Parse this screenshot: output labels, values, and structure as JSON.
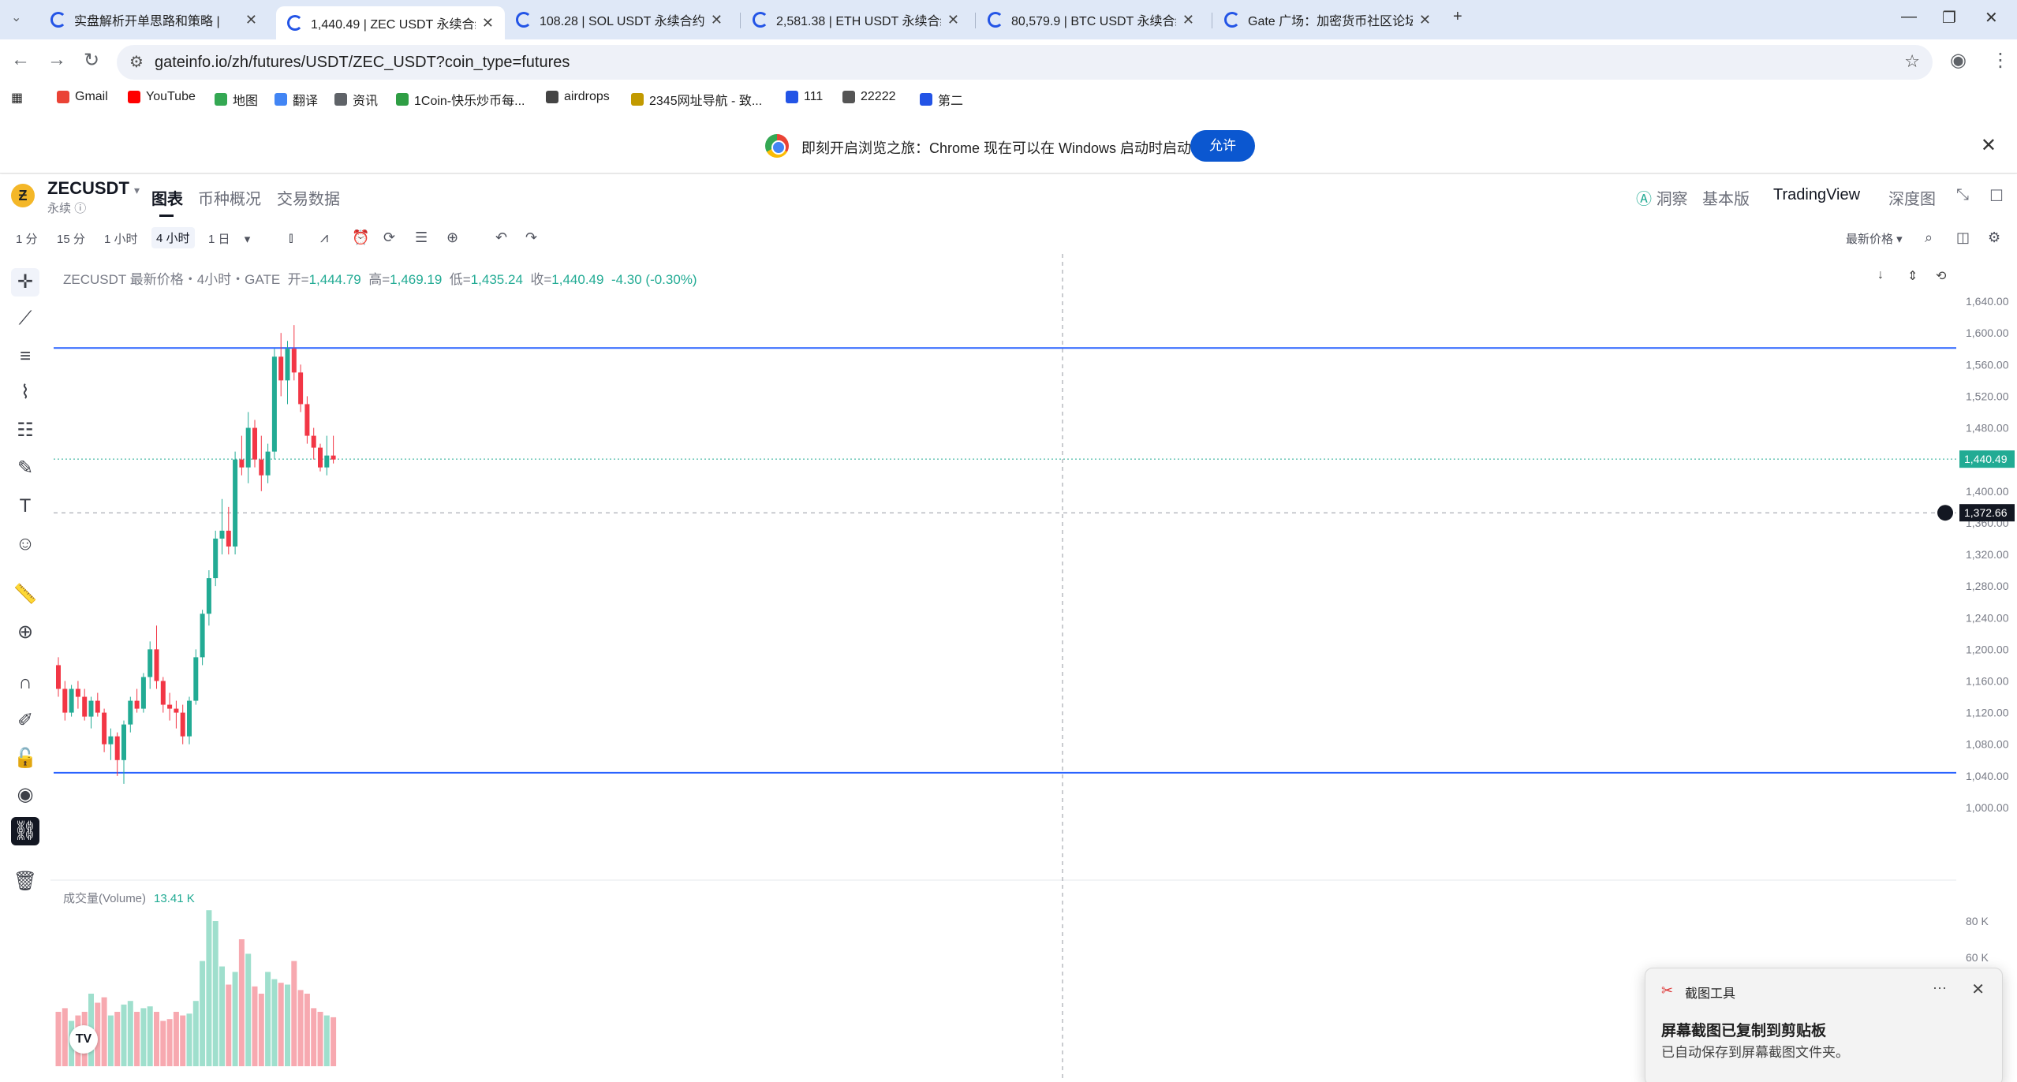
{
  "browser": {
    "tabs": [
      {
        "title": "实盘解析开单思路和策略 |",
        "active": false
      },
      {
        "title": "1,440.49 | ZEC USDT 永续合约",
        "active": true
      },
      {
        "title": "108.28 | SOL USDT 永续合约 |",
        "active": false
      },
      {
        "title": "2,581.38 | ETH USDT 永续合约",
        "active": false
      },
      {
        "title": "80,579.9 | BTC USDT 永续合约",
        "active": false
      },
      {
        "title": "Gate 广场：加密货币社区论坛",
        "active": false
      }
    ],
    "new_tab": "+",
    "url": "gateinfo.io/zh/futures/USDT/ZEC_USDT?coin_type=futures",
    "bookmarks": [
      "Gmail",
      "YouTube",
      "地图",
      "翻译",
      "资讯",
      "1Coin-快乐炒币每...",
      "airdrops",
      "2345网址导航 - 致...",
      "111",
      "22222",
      "第二"
    ],
    "infobar": {
      "text": "即刻开启浏览之旅：Chrome 现在可以在 Windows 启动时启动。",
      "button": "允许"
    }
  },
  "header": {
    "symbol": "ZECUSDT",
    "subtitle": "永续",
    "tabs": [
      "图表",
      "币种概况",
      "交易数据"
    ],
    "right": [
      "洞察",
      "基本版",
      "TradingView",
      "深度图"
    ]
  },
  "toolbar": {
    "timeframes": [
      "1 分",
      "15 分",
      "1 小时",
      "4 小时",
      "1 日"
    ],
    "active_timeframe": "4 小时",
    "price_type": "最新价格"
  },
  "legend": {
    "title": "ZECUSDT 最新价格・4小时・GATE",
    "open_label": "开=",
    "open": "1,444.79",
    "high_label": "高=",
    "high": "1,469.19",
    "low_label": "低=",
    "low": "1,435.24",
    "close_label": "收=",
    "close": "1,440.49",
    "change": "-4.30 (-0.30%)"
  },
  "volume_legend": {
    "label": "成交量(Volume)",
    "value": "13.41 K"
  },
  "colors": {
    "up": "#22ab94",
    "down": "#f23645",
    "hline": "#2962ff"
  },
  "chart_data": {
    "type": "candlestick",
    "y_ticks": [
      "1,640.00",
      "1,600.00",
      "1,560.00",
      "1,520.00",
      "1,480.00",
      "1,440.00",
      "1,400.00",
      "1,360.00",
      "1,320.00",
      "1,280.00",
      "1,240.00",
      "1,200.00",
      "1,160.00",
      "1,120.00",
      "1,080.00",
      "1,040.00",
      "1,000.00"
    ],
    "ylim": [
      990,
      1660
    ],
    "last_price": "1,440.49",
    "crosshair_price": "1,372.66",
    "horizontal_lines": [
      1581,
      1044
    ],
    "volume_ticks": [
      "80 K",
      "60 K"
    ],
    "volume_ylim": [
      0,
      100
    ],
    "candles": [
      [
        1180,
        1190,
        1140,
        1150
      ],
      [
        1150,
        1160,
        1110,
        1120
      ],
      [
        1120,
        1155,
        1115,
        1150
      ],
      [
        1150,
        1160,
        1125,
        1140
      ],
      [
        1140,
        1150,
        1110,
        1115
      ],
      [
        1115,
        1140,
        1100,
        1135
      ],
      [
        1135,
        1145,
        1115,
        1120
      ],
      [
        1120,
        1125,
        1070,
        1080
      ],
      [
        1080,
        1100,
        1060,
        1090
      ],
      [
        1090,
        1095,
        1040,
        1060
      ],
      [
        1060,
        1110,
        1030,
        1105
      ],
      [
        1105,
        1140,
        1095,
        1135
      ],
      [
        1135,
        1150,
        1120,
        1125
      ],
      [
        1125,
        1170,
        1120,
        1165
      ],
      [
        1165,
        1210,
        1150,
        1200
      ],
      [
        1200,
        1230,
        1150,
        1160
      ],
      [
        1160,
        1165,
        1120,
        1130
      ],
      [
        1130,
        1145,
        1110,
        1125
      ],
      [
        1125,
        1135,
        1100,
        1120
      ],
      [
        1120,
        1130,
        1080,
        1090
      ],
      [
        1090,
        1140,
        1080,
        1135
      ],
      [
        1135,
        1200,
        1130,
        1190
      ],
      [
        1190,
        1250,
        1180,
        1245
      ],
      [
        1245,
        1300,
        1230,
        1290
      ],
      [
        1290,
        1350,
        1280,
        1340
      ],
      [
        1340,
        1390,
        1320,
        1350
      ],
      [
        1350,
        1380,
        1320,
        1330
      ],
      [
        1330,
        1450,
        1320,
        1440
      ],
      [
        1440,
        1470,
        1420,
        1430
      ],
      [
        1430,
        1500,
        1410,
        1480
      ],
      [
        1480,
        1490,
        1430,
        1440
      ],
      [
        1440,
        1470,
        1400,
        1420
      ],
      [
        1420,
        1460,
        1410,
        1450
      ],
      [
        1450,
        1580,
        1440,
        1570
      ],
      [
        1570,
        1600,
        1520,
        1540
      ],
      [
        1540,
        1590,
        1510,
        1580
      ],
      [
        1580,
        1610,
        1540,
        1550
      ],
      [
        1550,
        1560,
        1500,
        1510
      ],
      [
        1510,
        1520,
        1460,
        1470
      ],
      [
        1470,
        1480,
        1440,
        1455
      ],
      [
        1455,
        1460,
        1425,
        1430
      ],
      [
        1430,
        1470,
        1420,
        1445
      ],
      [
        1445,
        1470,
        1435,
        1440
      ]
    ],
    "volumes": [
      30,
      32,
      25,
      28,
      30,
      40,
      35,
      38,
      28,
      30,
      34,
      36,
      30,
      32,
      33,
      30,
      25,
      26,
      30,
      28,
      29,
      36,
      58,
      86,
      80,
      55,
      45,
      52,
      70,
      62,
      44,
      40,
      52,
      48,
      46,
      45,
      58,
      42,
      40,
      32,
      30,
      28,
      27
    ]
  }
}
